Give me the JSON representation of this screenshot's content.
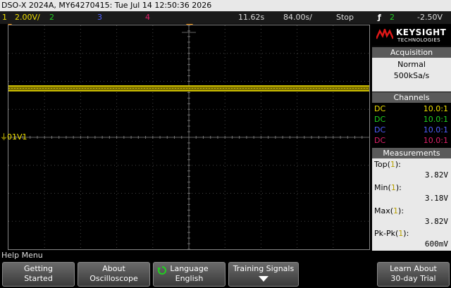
{
  "title_bar": "DSO-X 2024A, MY64270415: Tue Jul 14 12:50:36 2026",
  "status": {
    "ch1_number": "1",
    "ch1_scale": "2.00V/",
    "ch2_number": "2",
    "ch3_number": "3",
    "ch4_number": "4",
    "timebase": "11.62s",
    "delay": "84.00s/",
    "run_state": "Stop",
    "trigger_source": "2",
    "trigger_level": "-2.50V"
  },
  "colors": {
    "ch1": "#f0e000",
    "ch2": "#20d020",
    "ch3": "#5060ff",
    "ch4": "#e0206a",
    "trigger": "#f08a00"
  },
  "trace": {
    "ground_label": "01V1"
  },
  "brand": {
    "name": "KEYSIGHT",
    "sub": "TECHNOLOGIES"
  },
  "acquisition": {
    "header": "Acquisition",
    "mode": "Normal",
    "rate": "500kSa/s"
  },
  "channels": {
    "header": "Channels",
    "rows": [
      {
        "coupling": "DC",
        "probe": "10.0:1"
      },
      {
        "coupling": "DC",
        "probe": "10.0:1"
      },
      {
        "coupling": "DC",
        "probe": "10.0:1"
      },
      {
        "coupling": "DC",
        "probe": "10.0:1"
      }
    ]
  },
  "measurements": {
    "header": "Measurements",
    "items": [
      {
        "label": "Top(",
        "channel": "1",
        "suffix": "):",
        "value": "3.82V"
      },
      {
        "label": "Min(",
        "channel": "1",
        "suffix": "):",
        "value": "3.18V"
      },
      {
        "label": "Max(",
        "channel": "1",
        "suffix": "):",
        "value": "3.82V"
      },
      {
        "label": "Pk-Pk(",
        "channel": "1",
        "suffix": "):",
        "value": "600mV"
      }
    ]
  },
  "help_menu": "Help Menu",
  "softkeys": [
    {
      "line1": "Getting",
      "line2": "Started"
    },
    {
      "line1": "About",
      "line2": "Oscilloscope"
    },
    {
      "line1": "Language",
      "line2": "English"
    },
    {
      "line1": "Training Signals",
      "line2": ""
    },
    {
      "line1": "Learn About",
      "line2": "30-day Trial"
    }
  ]
}
